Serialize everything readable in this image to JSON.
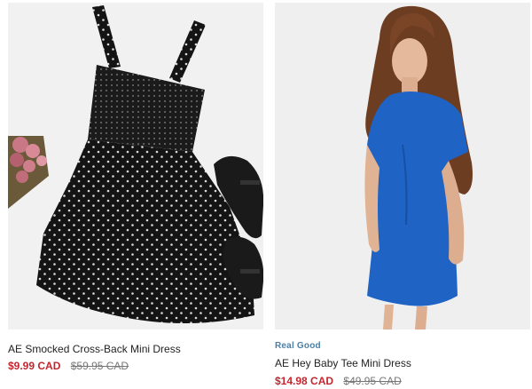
{
  "products": [
    {
      "name": "AE Smocked Cross-Back Mini Dress",
      "badge": "",
      "sale_price": "$9.99 CAD",
      "original_price": "$59.95 CAD",
      "image_icon": "dress-image"
    },
    {
      "name": "AE Hey Baby Tee Mini Dress",
      "badge": "Real Good",
      "sale_price": "$14.98 CAD",
      "original_price": "$49.95 CAD",
      "image_icon": "model-image"
    }
  ],
  "colors": {
    "sale_price": "#c4262e",
    "original_price": "#777777",
    "badge": "#4a7fa6",
    "name": "#222222"
  }
}
